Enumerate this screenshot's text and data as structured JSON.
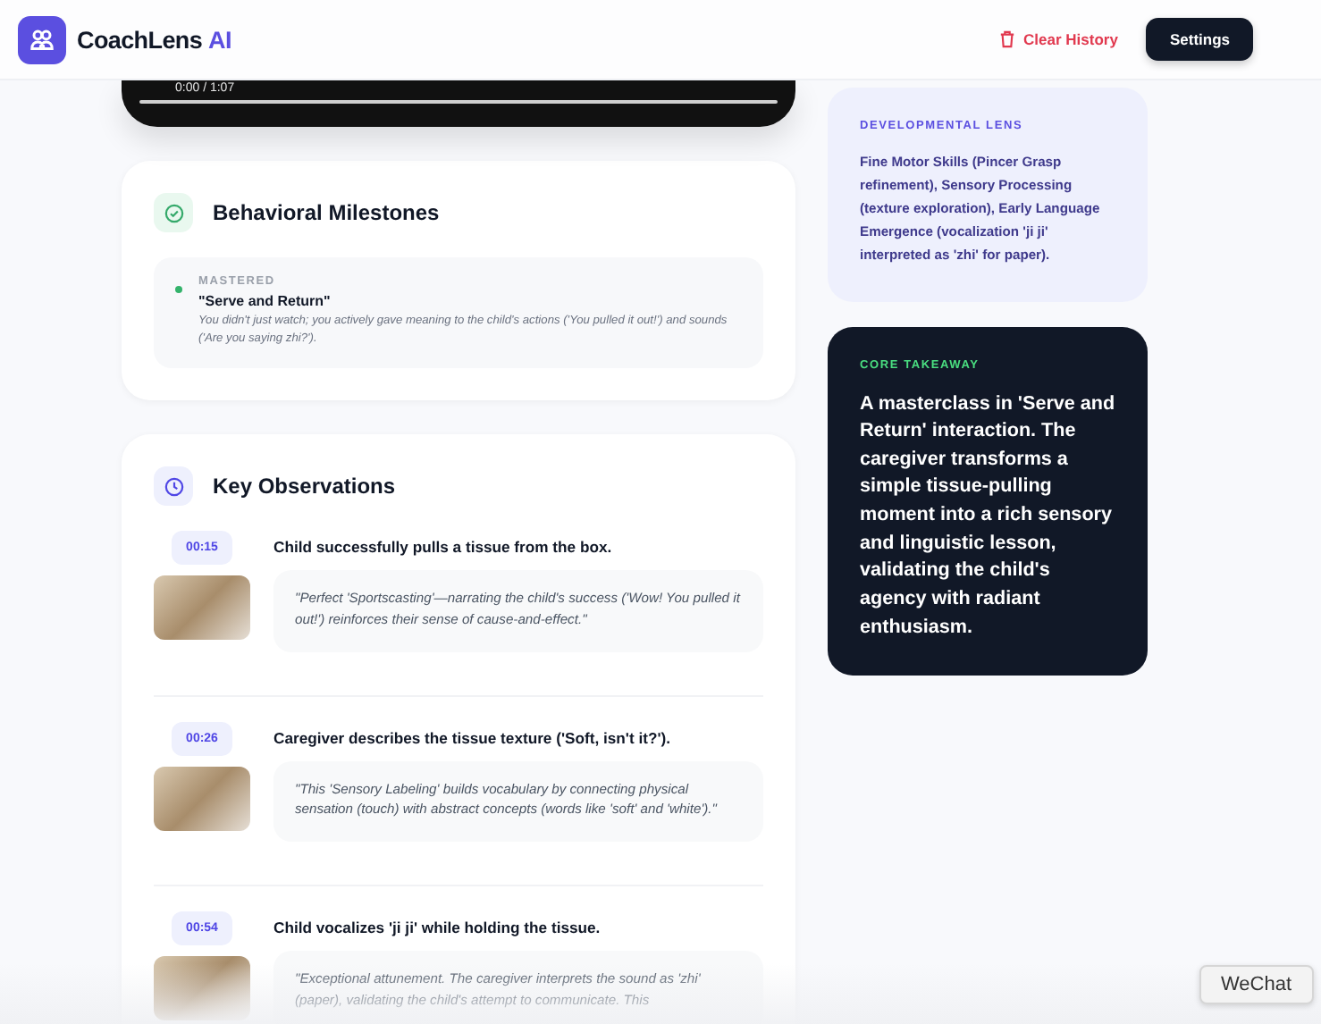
{
  "app": {
    "name": "CoachLens",
    "name_accent": "AI"
  },
  "header_actions": {
    "clear_history": "Clear History",
    "settings": "Settings"
  },
  "video": {
    "time": "0:00 / 1:07",
    "level": 0
  },
  "milestones": {
    "title": "Behavioral Milestones",
    "items": [
      {
        "status": "MASTERED",
        "title": "\"Serve and Return\"",
        "description": "You didn't just watch; you actively gave meaning to the child's actions ('You pulled it out!') and sounds ('Are you saying zhi?')."
      }
    ]
  },
  "observations": {
    "title": "Key Observations",
    "items": [
      {
        "time": "00:15",
        "event": "Child successfully pulls a tissue from the box.",
        "comment": "\"Perfect 'Sportscasting'—narrating the child's success ('Wow! You pulled it out!') reinforces their sense of cause-and-effect.\""
      },
      {
        "time": "00:26",
        "event": "Caregiver describes the tissue texture ('Soft, isn't it?').",
        "comment": "\"This 'Sensory Labeling' builds vocabulary by connecting physical sensation (touch) with abstract concepts (words like 'soft' and 'white').\""
      },
      {
        "time": "00:54",
        "event": "Child vocalizes 'ji ji' while holding the tissue.",
        "comment": "\"Exceptional attunement. The caregiver interprets the sound as 'zhi' (paper), validating the child's attempt to communicate. This"
      }
    ]
  },
  "developmental_lens": {
    "label": "DEVELOPMENTAL LENS",
    "text": "Fine Motor Skills (Pincer Grasp refinement), Sensory Processing (texture exploration), Early Language Emergence (vocalization 'ji ji' interpreted as 'zhi' for paper)."
  },
  "core_takeaway": {
    "label": "CORE TAKEAWAY",
    "text": "A masterclass in 'Serve and Return' interaction. The caregiver transforms a simple tissue-pulling moment into a rich sensory and linguistic lesson, validating the child's agency with radiant enthusiasm."
  },
  "tooltip": "WeChat"
}
